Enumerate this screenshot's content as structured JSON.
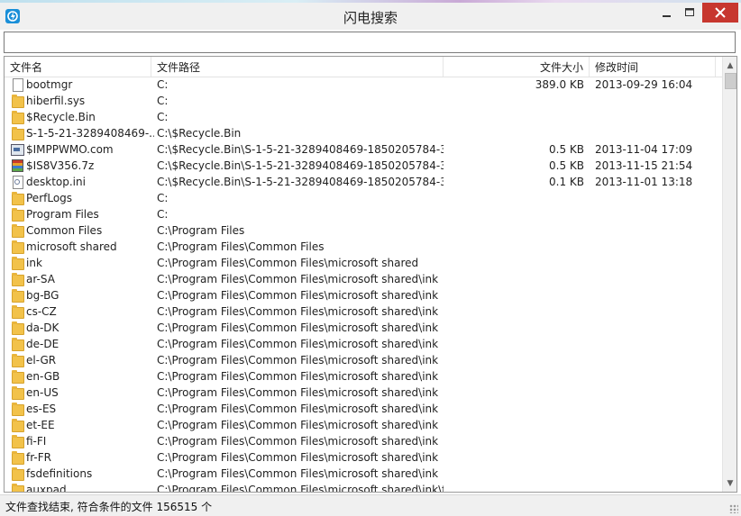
{
  "window": {
    "title": "闪电搜索",
    "minimize_label": "—",
    "maximize_label": "☐",
    "close_label": "✕"
  },
  "search": {
    "value": "",
    "placeholder": ""
  },
  "list": {
    "columns": [
      "文件名",
      "文件路径",
      "文件大小",
      "修改时间"
    ],
    "rows": [
      {
        "icon": "file-icon",
        "name": "bootmgr",
        "path": "C:",
        "size": "389.0 KB",
        "time": "2013-09-29 16:04"
      },
      {
        "icon": "folder-icon",
        "name": "hiberfil.sys",
        "path": "C:",
        "size": "",
        "time": ""
      },
      {
        "icon": "folder-icon",
        "name": "$Recycle.Bin",
        "path": "C:",
        "size": "",
        "time": ""
      },
      {
        "icon": "folder-icon",
        "name": "S-1-5-21-3289408469-...",
        "path": "C:\\$Recycle.Bin",
        "size": "",
        "time": ""
      },
      {
        "icon": "exe-icon",
        "name": "$IMPPWMO.com",
        "path": "C:\\$Recycle.Bin\\S-1-5-21-3289408469-1850205784-3...",
        "size": "0.5 KB",
        "time": "2013-11-04 17:09"
      },
      {
        "icon": "archive-icon",
        "name": "$IS8V356.7z",
        "path": "C:\\$Recycle.Bin\\S-1-5-21-3289408469-1850205784-3...",
        "size": "0.5 KB",
        "time": "2013-11-15 21:54"
      },
      {
        "icon": "settings-file-icon",
        "name": "desktop.ini",
        "path": "C:\\$Recycle.Bin\\S-1-5-21-3289408469-1850205784-3...",
        "size": "0.1 KB",
        "time": "2013-11-01 13:18"
      },
      {
        "icon": "folder-icon",
        "name": "PerfLogs",
        "path": "C:",
        "size": "",
        "time": ""
      },
      {
        "icon": "folder-icon",
        "name": "Program Files",
        "path": "C:",
        "size": "",
        "time": ""
      },
      {
        "icon": "folder-icon",
        "name": "Common Files",
        "path": "C:\\Program Files",
        "size": "",
        "time": ""
      },
      {
        "icon": "folder-icon",
        "name": "microsoft shared",
        "path": "C:\\Program Files\\Common Files",
        "size": "",
        "time": ""
      },
      {
        "icon": "folder-icon",
        "name": "ink",
        "path": "C:\\Program Files\\Common Files\\microsoft shared",
        "size": "",
        "time": ""
      },
      {
        "icon": "folder-icon",
        "name": "ar-SA",
        "path": "C:\\Program Files\\Common Files\\microsoft shared\\ink",
        "size": "",
        "time": ""
      },
      {
        "icon": "folder-icon",
        "name": "bg-BG",
        "path": "C:\\Program Files\\Common Files\\microsoft shared\\ink",
        "size": "",
        "time": ""
      },
      {
        "icon": "folder-icon",
        "name": "cs-CZ",
        "path": "C:\\Program Files\\Common Files\\microsoft shared\\ink",
        "size": "",
        "time": ""
      },
      {
        "icon": "folder-icon",
        "name": "da-DK",
        "path": "C:\\Program Files\\Common Files\\microsoft shared\\ink",
        "size": "",
        "time": ""
      },
      {
        "icon": "folder-icon",
        "name": "de-DE",
        "path": "C:\\Program Files\\Common Files\\microsoft shared\\ink",
        "size": "",
        "time": ""
      },
      {
        "icon": "folder-icon",
        "name": "el-GR",
        "path": "C:\\Program Files\\Common Files\\microsoft shared\\ink",
        "size": "",
        "time": ""
      },
      {
        "icon": "folder-icon",
        "name": "en-GB",
        "path": "C:\\Program Files\\Common Files\\microsoft shared\\ink",
        "size": "",
        "time": ""
      },
      {
        "icon": "folder-icon",
        "name": "en-US",
        "path": "C:\\Program Files\\Common Files\\microsoft shared\\ink",
        "size": "",
        "time": ""
      },
      {
        "icon": "folder-icon",
        "name": "es-ES",
        "path": "C:\\Program Files\\Common Files\\microsoft shared\\ink",
        "size": "",
        "time": ""
      },
      {
        "icon": "folder-icon",
        "name": "et-EE",
        "path": "C:\\Program Files\\Common Files\\microsoft shared\\ink",
        "size": "",
        "time": ""
      },
      {
        "icon": "folder-icon",
        "name": "fi-FI",
        "path": "C:\\Program Files\\Common Files\\microsoft shared\\ink",
        "size": "",
        "time": ""
      },
      {
        "icon": "folder-icon",
        "name": "fr-FR",
        "path": "C:\\Program Files\\Common Files\\microsoft shared\\ink",
        "size": "",
        "time": ""
      },
      {
        "icon": "folder-icon",
        "name": "fsdefinitions",
        "path": "C:\\Program Files\\Common Files\\microsoft shared\\ink",
        "size": "",
        "time": ""
      },
      {
        "icon": "folder-icon",
        "name": "auxpad",
        "path": "C:\\Program Files\\Common Files\\microsoft shared\\ink\\fs...",
        "size": "",
        "time": ""
      }
    ]
  },
  "status": {
    "text": "文件查找结束, 符合条件的文件 156515 个"
  },
  "colors": {
    "close_button": "#c7372f",
    "folder": "#f2c24a",
    "app_icon": "#1a8fd8"
  }
}
